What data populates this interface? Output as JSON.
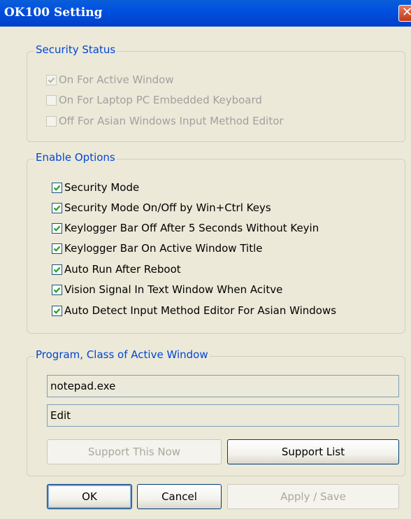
{
  "window": {
    "title": "OK100 Setting",
    "close_glyph": "✕"
  },
  "security_status": {
    "legend": "Security Status",
    "items": [
      {
        "label": "On For Active Window",
        "checked": true,
        "enabled": false
      },
      {
        "label": "On For Laptop PC Embedded Keyboard",
        "checked": false,
        "enabled": false
      },
      {
        "label": "Off For Asian Windows Input Method Editor",
        "checked": false,
        "enabled": false
      }
    ]
  },
  "enable_options": {
    "legend": "Enable Options",
    "items": [
      {
        "label": "Security Mode",
        "checked": true
      },
      {
        "label": "Security Mode On/Off by Win+Ctrl Keys",
        "checked": true
      },
      {
        "label": "Keylogger Bar Off After 5 Seconds Without Keyin",
        "checked": true
      },
      {
        "label": "Keylogger Bar On Active Window Title",
        "checked": true
      },
      {
        "label": "Auto Run After Reboot",
        "checked": true
      },
      {
        "label": "Vision Signal In Text Window When Acitve",
        "checked": true
      },
      {
        "label": "Auto Detect Input Method Editor For Asian Windows",
        "checked": true
      }
    ]
  },
  "active_window": {
    "legend": "Program, Class of Active Window",
    "program": "notepad.exe",
    "class": "Edit",
    "support_now_label": "Support This Now",
    "support_list_label": "Support List"
  },
  "buttons": {
    "ok": "OK",
    "cancel": "Cancel",
    "apply_save": "Apply / Save"
  },
  "colors": {
    "accent_legend": "#0046d5",
    "titlebar": "#0050e0",
    "check": "#21a121"
  }
}
